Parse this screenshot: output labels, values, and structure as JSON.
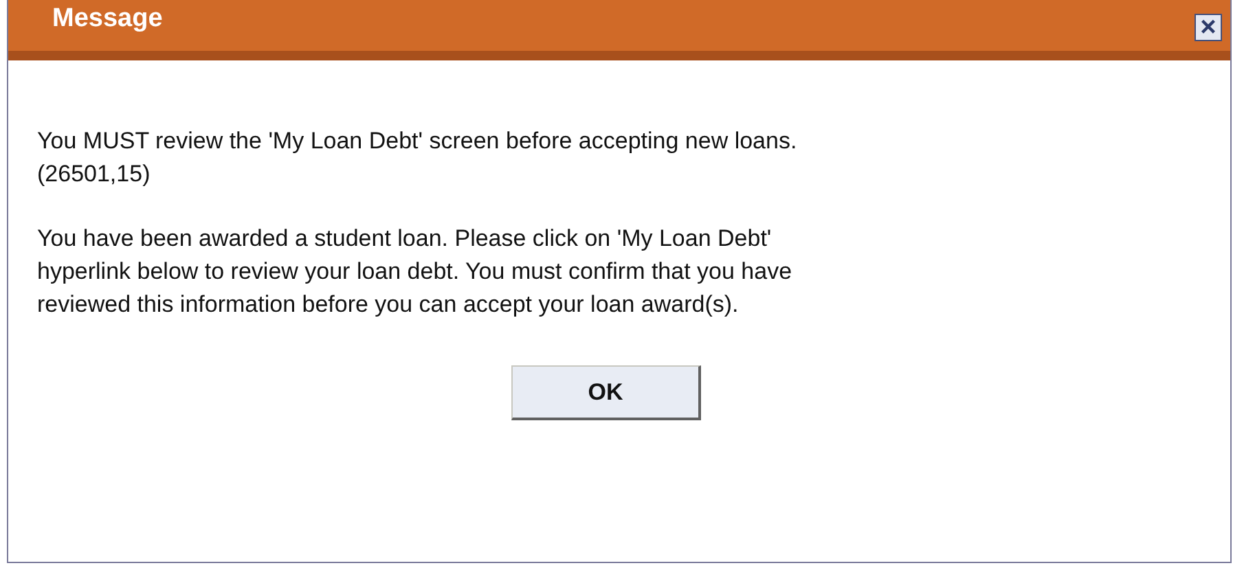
{
  "window": {
    "title": "Message",
    "close": "×"
  },
  "paragraphs": [
    "You MUST review the 'My Loan Debt' screen before accepting new loans.\n(26501,15)",
    "You have been awarded a student loan. Please click on 'My Loan Debt'\nhyperlink below to review your loan debt. You must confirm that you have\nreviewed this information before you can accept your loan award(s)."
  ],
  "buttons": [
    "OK"
  ]
}
